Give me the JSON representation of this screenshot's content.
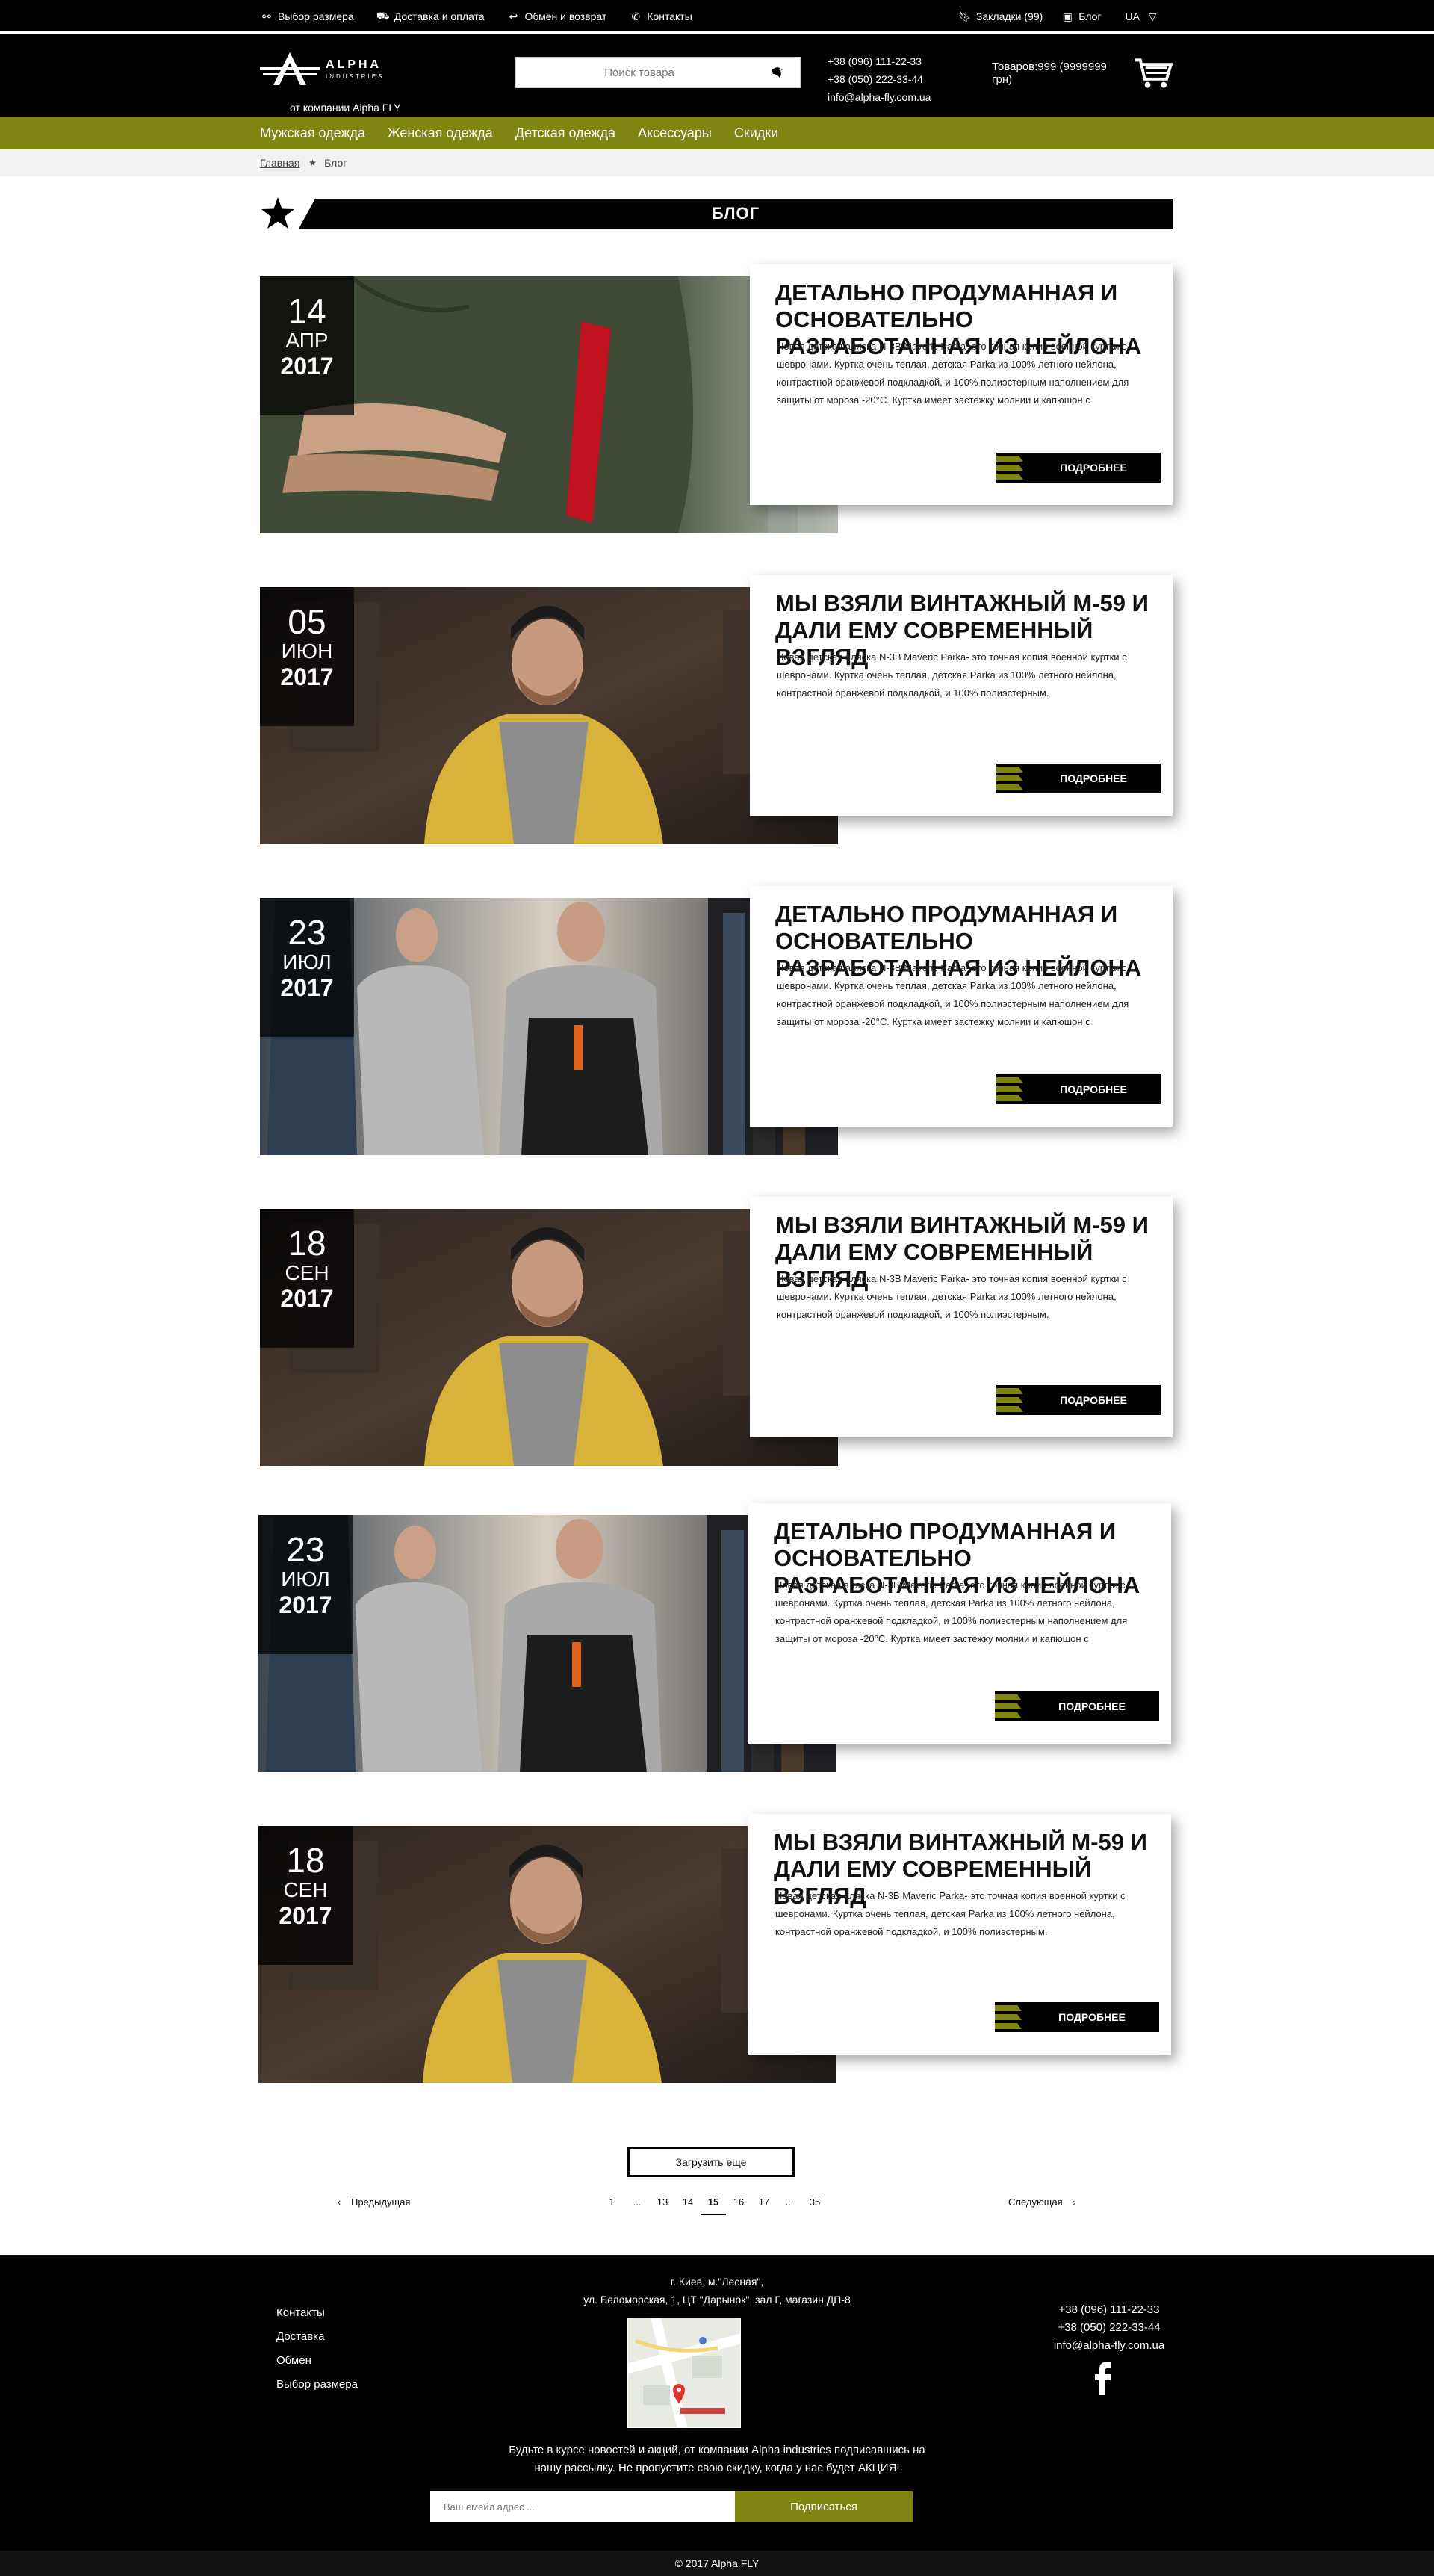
{
  "topbar": {
    "items": [
      {
        "label": "Выбор размера",
        "icon": "size-icon"
      },
      {
        "label": "Доставка и оплата",
        "icon": "truck-icon"
      },
      {
        "label": "Обмен и возврат",
        "icon": "return-icon"
      },
      {
        "label": "Контакты",
        "icon": "phone-icon"
      }
    ],
    "bookmarks": "Закладки (99)",
    "blog": "Блог",
    "lang": "UA"
  },
  "header": {
    "logo_word": "ALPHA",
    "logo_sub": "INDUSTRIES",
    "company": "от компании Alpha FLY",
    "search_placeholder": "Поиск товара",
    "phones": [
      "+38 (096) 111-22-33",
      "+38 (050) 222-33-44",
      "info@alpha-fly.com.ua"
    ],
    "cart": "Товаров:999 (9999999 грн)"
  },
  "nav": [
    "Мужская одежда",
    "Женская одежда",
    "Детская одежда",
    "Аксессуары",
    "Скидки"
  ],
  "breadcrumbs": {
    "home": "Главная",
    "current": "Блог"
  },
  "section_title": "БЛОГ",
  "posts": [
    {
      "day": "14",
      "month": "АПР",
      "year": "2017",
      "title": "ДЕТАЛЬНО ПРОДУМАННАЯ И ОСНОВАТЕЛЬНО РАЗРАБОТАННАЯ ИЗ НЕЙЛОНА",
      "text": "Новая детская аляска N-3B Maveric Parka- это точная копия военной куртки с шевронами. Куртка очень теплая, детская Parka из 100% летного нейлона, контрастной оранжевой подкладкой, и 100% полиэстерным наполнением для защиты от мороза -20°С. Куртка имеет застежку молнии и капюшон с",
      "more": "ПОДРОБНЕЕ",
      "image": "jacket-sleeve"
    },
    {
      "day": "05",
      "month": "ИЮН",
      "year": "2017",
      "title": "МЫ ВЗЯЛИ ВИНТАЖНЫЙ М-59 И ДАЛИ ЕМУ СОВРЕМЕННЫЙ ВЗГЛЯД",
      "text": "Новая детская аляска N-3B Maveric Parka- это точная копия военной куртки с шевронами. Куртка очень теплая, детская Parka из 100% летного нейлона, контрастной оранжевой подкладкой, и 100% полиэстерным.",
      "more": "ПОДРОБНЕЕ",
      "image": "man-yellow"
    },
    {
      "day": "23",
      "month": "ИЮЛ",
      "year": "2017",
      "title": "ДЕТАЛЬНО ПРОДУМАННАЯ И ОСНОВАТЕЛЬНО РАЗРАБОТАННАЯ ИЗ НЕЙЛОНА",
      "text": "Новая детская аляска N-3B Maveric Parka- это точная копия военной куртки с шевронами. Куртка очень теплая, детская Parka из 100% летного нейлона, контрастной оранжевой подкладкой, и 100% полиэстерным наполнением для защиты от мороза -20°С. Куртка имеет застежку молнии и капюшон с",
      "more": "ПОДРОБНЕЕ",
      "image": "men-rack"
    },
    {
      "day": "18",
      "month": "СЕН",
      "year": "2017",
      "title": "МЫ ВЗЯЛИ ВИНТАЖНЫЙ М-59 И ДАЛИ ЕМУ СОВРЕМЕННЫЙ ВЗГЛЯД",
      "text": "Новая детская аляска N-3B Maveric Parka- это точная копия военной куртки с шевронами. Куртка очень теплая, детская Parka из 100% летного нейлона, контрастной оранжевой подкладкой, и 100% полиэстерным.",
      "more": "ПОДРОБНЕЕ",
      "image": "man-yellow"
    },
    {
      "day": "23",
      "month": "ИЮЛ",
      "year": "2017",
      "title": "ДЕТАЛЬНО ПРОДУМАННАЯ И ОСНОВАТЕЛЬНО РАЗРАБОТАННАЯ ИЗ НЕЙЛОНА",
      "text": "Новая детская аляска N-3B Maveric Parka- это точная копия военной куртки с шевронами. Куртка очень теплая, детская Parka из 100% летного нейлона, контрастной оранжевой подкладкой, и 100% полиэстерным наполнением для защиты от мороза -20°С. Куртка имеет застежку молнии и капюшон с",
      "more": "ПОДРОБНЕЕ",
      "image": "men-rack"
    },
    {
      "day": "18",
      "month": "СЕН",
      "year": "2017",
      "title": "МЫ ВЗЯЛИ ВИНТАЖНЫЙ М-59 И ДАЛИ ЕМУ СОВРЕМЕННЫЙ ВЗГЛЯД",
      "text": "Новая детская аляска N-3B Maveric Parka- это точная копия военной куртки с шевронами. Куртка очень теплая, детская Parka из 100% летного нейлона, контрастной оранжевой подкладкой, и 100% полиэстерным.",
      "more": "ПОДРОБНЕЕ",
      "image": "man-yellow"
    }
  ],
  "load_more": "Загрузить еще",
  "pagination": {
    "prev": "Предыдущая",
    "next": "Следующая",
    "pages": [
      "1",
      "...",
      "13",
      "14",
      "15",
      "16",
      "17",
      "...",
      "35"
    ],
    "current": "15"
  },
  "footer": {
    "links": [
      "Контакты",
      "Доставка",
      "Обмен",
      "Выбор размера"
    ],
    "address": [
      "г. Киев, м.\"Лесная\",",
      "ул. Беломорская, 1, ЦТ \"Дарынок\", зал Г, магазин ДП-8"
    ],
    "contacts": [
      "+38 (096) 111-22-33",
      "+38 (050) 222-33-44",
      "info@alpha-fly.com.ua"
    ],
    "subscribe_text": [
      "Будьте в курсе новостей и акций, от компании Alpha industries подписавшись на",
      "нашу рассылку. Не пропустите свою скидку, когда у нас будет АКЦИЯ!"
    ],
    "email_placeholder": "Ваш емейл адрес ...",
    "subscribe_button": "Подписаться",
    "copyright": "© 2017 Alpha FLY"
  },
  "colors": {
    "accent": "#7f8511",
    "dark": "#000000",
    "crumbs_bg": "#f2f2f2"
  }
}
